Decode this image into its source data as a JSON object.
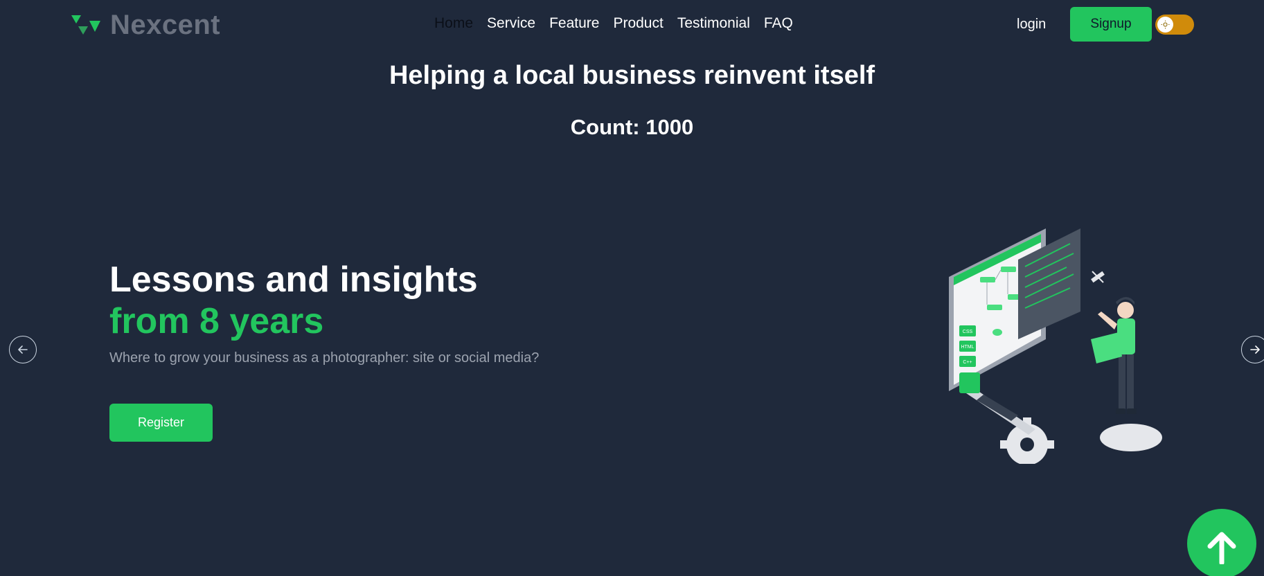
{
  "header": {
    "brand": "Nexcent",
    "nav": [
      {
        "label": "Home",
        "active": true
      },
      {
        "label": "Service"
      },
      {
        "label": "Feature"
      },
      {
        "label": "Product"
      },
      {
        "label": "Testimonial"
      },
      {
        "label": "FAQ"
      }
    ],
    "login_label": "login",
    "signup_label": "Signup",
    "theme_toggle": {
      "icon": "sun-icon"
    }
  },
  "main": {
    "headline": "Helping a local business reinvent itself",
    "count_text": "Count: 1000"
  },
  "hero": {
    "title_line1": "Lessons and insights",
    "title_line2": "from 8 years",
    "subtitle": "Where to grow your business as a photographer: site or social media?",
    "register_label": "Register",
    "illustration_labels": [
      "CSS",
      "HTML",
      "C++"
    ]
  },
  "colors": {
    "background": "#1f293b",
    "accent": "#22c55e",
    "toggle": "#d08b0b",
    "muted": "#9ca3af"
  }
}
